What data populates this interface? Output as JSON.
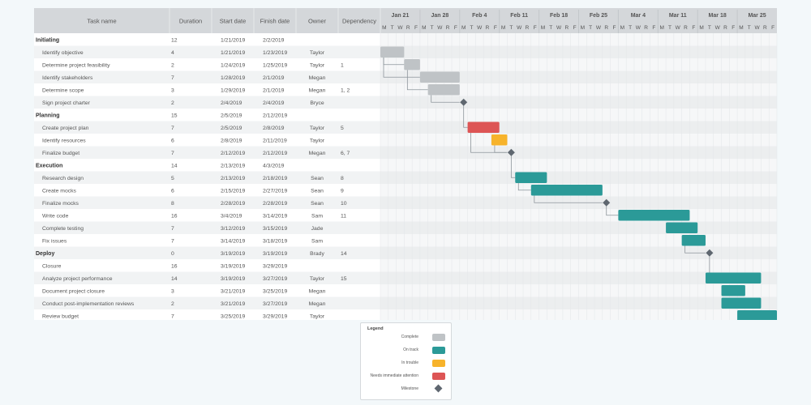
{
  "table": {
    "headers": {
      "task": "Task name",
      "duration": "Duration",
      "start": "Start date",
      "finish": "Finish date",
      "owner": "Owner",
      "dependency": "Dependency"
    }
  },
  "timeline": {
    "weeks": [
      "Jan 21",
      "Jan 28",
      "Feb 4",
      "Feb 11",
      "Feb 18",
      "Feb 25",
      "Mar 4",
      "Mar 11",
      "Mar 18",
      "Mar 25"
    ],
    "day_letters": [
      "M",
      "T",
      "W",
      "R",
      "F"
    ],
    "start_date": "2019-01-21"
  },
  "chart_data": {
    "type": "gantt",
    "title": "",
    "rows": [
      {
        "name": "Initiating",
        "duration": "12",
        "start": "1/21/2019",
        "finish": "2/2/2019",
        "owner": "",
        "dependency": "",
        "group": true,
        "status": ""
      },
      {
        "name": "Identify objective",
        "duration": "4",
        "start": "1/21/2019",
        "finish": "1/23/2019",
        "owner": "Taylor",
        "dependency": "",
        "group": false,
        "status": "Complete"
      },
      {
        "name": "Determine project feasibility",
        "duration": "2",
        "start": "1/24/2019",
        "finish": "1/25/2019",
        "owner": "Taylor",
        "dependency": "1",
        "group": false,
        "status": "Complete"
      },
      {
        "name": "Identify stakeholders",
        "duration": "7",
        "start": "1/28/2019",
        "finish": "2/1/2019",
        "owner": "Megan",
        "dependency": "",
        "group": false,
        "status": "Complete"
      },
      {
        "name": "Determine scope",
        "duration": "3",
        "start": "1/29/2019",
        "finish": "2/1/2019",
        "owner": "Megan",
        "dependency": "1, 2",
        "group": false,
        "status": "Complete"
      },
      {
        "name": "Sign project charter",
        "duration": "2",
        "start": "2/4/2019",
        "finish": "2/4/2019",
        "owner": "Bryce",
        "dependency": "",
        "group": false,
        "status": "Milestone"
      },
      {
        "name": "Planning",
        "duration": "15",
        "start": "2/5/2019",
        "finish": "2/12/2019",
        "owner": "",
        "dependency": "",
        "group": true,
        "status": ""
      },
      {
        "name": "Create project plan",
        "duration": "7",
        "start": "2/5/2019",
        "finish": "2/8/2019",
        "owner": "Taylor",
        "dependency": "5",
        "group": false,
        "status": "Needs immediate attention"
      },
      {
        "name": "Identify resources",
        "duration": "6",
        "start": "2/8/2019",
        "finish": "2/11/2019",
        "owner": "Taylor",
        "dependency": "",
        "group": false,
        "status": "In trouble"
      },
      {
        "name": "Finalize budget",
        "duration": "7",
        "start": "2/12/2019",
        "finish": "2/12/2019",
        "owner": "Megan",
        "dependency": "6, 7",
        "group": false,
        "status": "Milestone"
      },
      {
        "name": "Execution",
        "duration": "14",
        "start": "2/13/2019",
        "finish": "4/3/2019",
        "owner": "",
        "dependency": "",
        "group": true,
        "status": ""
      },
      {
        "name": "Research design",
        "duration": "5",
        "start": "2/13/2019",
        "finish": "2/18/2019",
        "owner": "Sean",
        "dependency": "8",
        "group": false,
        "status": "On track"
      },
      {
        "name": "Create mocks",
        "duration": "6",
        "start": "2/15/2019",
        "finish": "2/27/2019",
        "owner": "Sean",
        "dependency": "9",
        "group": false,
        "status": "On track"
      },
      {
        "name": "Finalize mocks",
        "duration": "8",
        "start": "2/28/2019",
        "finish": "2/28/2019",
        "owner": "Sean",
        "dependency": "10",
        "group": false,
        "status": "Milestone"
      },
      {
        "name": "Write code",
        "duration": "16",
        "start": "3/4/2019",
        "finish": "3/14/2019",
        "owner": "Sam",
        "dependency": "11",
        "group": false,
        "status": "On track"
      },
      {
        "name": "Complete testing",
        "duration": "7",
        "start": "3/12/2019",
        "finish": "3/15/2019",
        "owner": "Jade",
        "dependency": "",
        "group": false,
        "status": "On track"
      },
      {
        "name": "Fix issues",
        "duration": "7",
        "start": "3/14/2019",
        "finish": "3/18/2019",
        "owner": "Sam",
        "dependency": "",
        "group": false,
        "status": "On track"
      },
      {
        "name": "Deploy",
        "duration": "0",
        "start": "3/19/2019",
        "finish": "3/19/2019",
        "owner": "Brady",
        "dependency": "14",
        "group": true,
        "status": "Milestone"
      },
      {
        "name": "Closure",
        "duration": "16",
        "start": "3/19/2019",
        "finish": "3/29/2019",
        "owner": "",
        "dependency": "",
        "group": false,
        "status": ""
      },
      {
        "name": "Analyze project performance",
        "duration": "14",
        "start": "3/19/2019",
        "finish": "3/27/2019",
        "owner": "Taylor",
        "dependency": "15",
        "group": false,
        "status": "On track"
      },
      {
        "name": "Document project closure",
        "duration": "3",
        "start": "3/21/2019",
        "finish": "3/25/2019",
        "owner": "Megan",
        "dependency": "",
        "group": false,
        "status": "On track"
      },
      {
        "name": "Conduct post-implementation reviews",
        "duration": "2",
        "start": "3/21/2019",
        "finish": "3/27/2019",
        "owner": "Megan",
        "dependency": "",
        "group": false,
        "status": "On track"
      },
      {
        "name": "Review budget",
        "duration": "7",
        "start": "3/25/2019",
        "finish": "3/29/2019",
        "owner": "Taylor",
        "dependency": "",
        "group": false,
        "status": "On track"
      }
    ],
    "dependency_links": [
      [
        1,
        2
      ],
      [
        1,
        3
      ],
      [
        2,
        4
      ],
      [
        4,
        5
      ],
      [
        5,
        7
      ],
      [
        7,
        9
      ],
      [
        8,
        9
      ],
      [
        9,
        11
      ],
      [
        11,
        12
      ],
      [
        12,
        13
      ],
      [
        13,
        14
      ],
      [
        16,
        17
      ],
      [
        17,
        19
      ]
    ]
  },
  "legend": {
    "title": "Legend",
    "items": [
      {
        "label": "Complete",
        "color": "#bfc3c6",
        "kind": "bar"
      },
      {
        "label": "On track",
        "color": "#2b9a98",
        "kind": "bar"
      },
      {
        "label": "In trouble",
        "color": "#f7b32b",
        "kind": "bar"
      },
      {
        "label": "Needs immediate attention",
        "color": "#dd5555",
        "kind": "bar"
      },
      {
        "label": "Milestone",
        "color": "#5f6770",
        "kind": "diamond"
      }
    ]
  },
  "colors": {
    "Complete": "#bfc3c6",
    "On track": "#2b9a98",
    "In trouble": "#f7b32b",
    "Needs immediate attention": "#dd5555",
    "Milestone": "#5f6770"
  }
}
